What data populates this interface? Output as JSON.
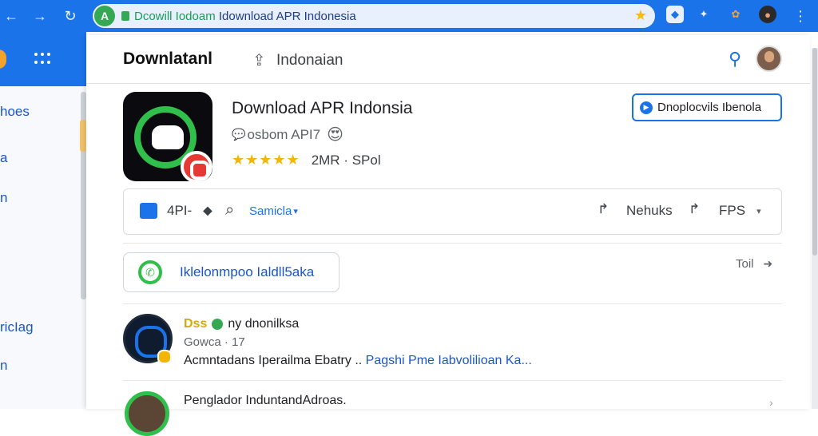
{
  "browser": {
    "back": "←",
    "forward": "→",
    "reload": "↻",
    "site_badge": "A",
    "url_highlight": "Dcowill Iodoam",
    "url_rest": " Idownload APR Indonesia",
    "star": "★",
    "ext_glyph_1": "◆",
    "ext_glyph_2": "✦",
    "ext_glyph_3": "✿",
    "ext_glyph_4": "●",
    "menu": "⋮"
  },
  "sidebar": {
    "items": [
      "hoes",
      "a",
      "n",
      "ricIag",
      "n"
    ]
  },
  "header": {
    "brand": "Downlatanl",
    "share_glyph": "⇪",
    "region": "Indonaian",
    "search_glyph": "⚲"
  },
  "app": {
    "title": "Download APR Indonsia",
    "subtitle": "osbom API7",
    "subtitle_glyph": "💬",
    "emoji": "😍",
    "stars": "★★★★★",
    "rating_meta": "2MR · SPol",
    "download_label": "Dnoplocvils Ibenola"
  },
  "actions": {
    "apk_label": "4PI-",
    "bookmark_glyph": "⬥",
    "search_glyph": "⌕",
    "sort_label": "Samicla",
    "sort_caret": "▾",
    "nehuks_label": "Nehuks",
    "fps_label": "FPS",
    "fps_caret": "▾",
    "arrow_glyph": "↱"
  },
  "community": {
    "label": "Iklelonmpoo Ialdll5aka",
    "toll_label": "Toil",
    "toll_arrow": "➜"
  },
  "list": [
    {
      "handle": "Dss",
      "name": "ny dnonilksa",
      "meta": "Gowca · 17",
      "body": "Acmntadans Iperailma Ebatry .. ",
      "link": "Pagshi Pme Iabvolilioan Ka..."
    },
    {
      "title": "Penglador InduntandAdroas.",
      "chevron": "›"
    }
  ]
}
